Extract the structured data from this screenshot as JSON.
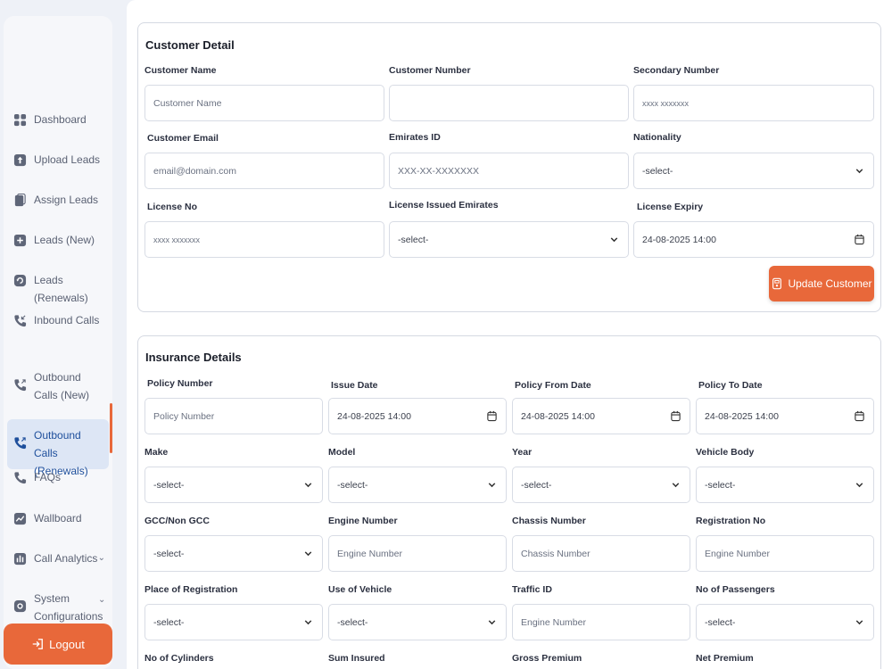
{
  "sidebar": {
    "items": [
      {
        "label": "Dashboard",
        "icon": "grid-icon"
      },
      {
        "label": "Upload Leads",
        "icon": "upload-icon"
      },
      {
        "label": "Assign Leads",
        "icon": "clipboard-icon"
      },
      {
        "label": "Leads (New)",
        "icon": "plus-square-icon"
      },
      {
        "label": "Leads (Renewals)",
        "icon": "refresh-icon"
      },
      {
        "label": "Inbound Calls",
        "icon": "phone-incoming-icon"
      },
      {
        "label": "Outbound Calls (New)",
        "icon": "phone-outgoing-icon"
      },
      {
        "label": "Outbound Calls (Renewals)",
        "icon": "phone-outgoing-icon"
      },
      {
        "label": "FAQs",
        "icon": "phone-icon"
      },
      {
        "label": "Wallboard",
        "icon": "trend-icon"
      },
      {
        "label": "Call Analytics",
        "icon": "bar-chart-icon"
      },
      {
        "label": "System Configurations",
        "icon": "gear-icon"
      }
    ],
    "active_index": 7,
    "logout_label": "Logout"
  },
  "customer": {
    "title": "Customer Detail",
    "fields": {
      "customer_name": {
        "label": "Customer Name",
        "placeholder": "Customer Name"
      },
      "customer_number": {
        "label": "Customer Number",
        "value": ""
      },
      "secondary_number": {
        "label": "Secondary Number",
        "placeholder": "xxxx xxxxxxx"
      },
      "customer_email": {
        "label": "Customer Email",
        "placeholder": "email@domain.com"
      },
      "emirates_id": {
        "label": "Emirates ID",
        "placeholder": "XXX-XX-XXXXXXX"
      },
      "nationality": {
        "label": "Nationality",
        "value": "-select-"
      },
      "license_no": {
        "label": "License No",
        "placeholder": "xxxx xxxxxxx"
      },
      "license_issued": {
        "label": "License Issued Emirates",
        "value": "-select-"
      },
      "license_expiry": {
        "label": "License Expiry",
        "value": "24-08-2025 14:00"
      }
    },
    "update_button": "Update Customer"
  },
  "insurance": {
    "title": "Insurance Details",
    "fields": {
      "policy_number": {
        "label": "Policy Number",
        "placeholder": "Policy Number"
      },
      "issue_date": {
        "label": "Issue Date",
        "value": "24-08-2025 14:00"
      },
      "policy_from": {
        "label": "Policy From Date",
        "value": "24-08-2025 14:00"
      },
      "policy_to": {
        "label": "Policy To Date",
        "value": "24-08-2025 14:00"
      },
      "make": {
        "label": "Make",
        "value": "-select-"
      },
      "model": {
        "label": "Model",
        "value": "-select-"
      },
      "year": {
        "label": "Year",
        "value": "-select-"
      },
      "vehicle_body": {
        "label": "Vehicle Body",
        "value": "-select-"
      },
      "gcc": {
        "label": "GCC/Non GCC",
        "value": "-select-"
      },
      "engine_number": {
        "label": "Engine Number",
        "placeholder": "Engine Number"
      },
      "chassis_number": {
        "label": "Chassis Number",
        "placeholder": "Chassis Number"
      },
      "registration_no": {
        "label": "Registration No",
        "placeholder": "Engine Number"
      },
      "place_registration": {
        "label": "Place of Registration",
        "value": "-select-"
      },
      "use_vehicle": {
        "label": "Use of Vehicle",
        "value": "-select-"
      },
      "traffic_id": {
        "label": "Traffic ID",
        "placeholder": "Engine Number"
      },
      "passengers": {
        "label": "No of Passengers",
        "value": "-select-"
      },
      "cylinders": {
        "label": "No of Cylinders"
      },
      "sum_insured": {
        "label": "Sum Insured"
      },
      "gross_premium": {
        "label": "Gross Premium"
      },
      "net_premium": {
        "label": "Net Premium"
      }
    }
  },
  "colors": {
    "accent": "#e8683a",
    "active_bg": "#dde6f5",
    "active_text": "#1e4f9c"
  }
}
